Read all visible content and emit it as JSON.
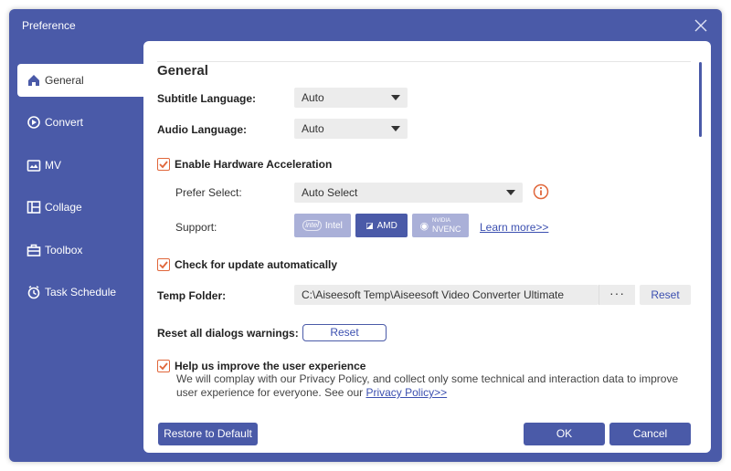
{
  "window": {
    "title": "Preference"
  },
  "sidebar": {
    "items": [
      {
        "label": "General",
        "icon": "home-icon",
        "active": true
      },
      {
        "label": "Convert",
        "icon": "convert-icon",
        "active": false
      },
      {
        "label": "MV",
        "icon": "mv-icon",
        "active": false
      },
      {
        "label": "Collage",
        "icon": "collage-icon",
        "active": false
      },
      {
        "label": "Toolbox",
        "icon": "toolbox-icon",
        "active": false
      },
      {
        "label": "Task Schedule",
        "icon": "clock-icon",
        "active": false
      }
    ]
  },
  "general": {
    "heading": "General",
    "subtitle_language": {
      "label": "Subtitle Language:",
      "value": "Auto"
    },
    "audio_language": {
      "label": "Audio Language:",
      "value": "Auto"
    },
    "hardware_acceleration": {
      "label": "Enable Hardware Acceleration",
      "checked": true,
      "prefer_label": "Prefer Select:",
      "prefer_value": "Auto Select",
      "support_label": "Support:",
      "intel": "Intel",
      "amd": "AMD",
      "nvidia_top": "NVIDIA",
      "nvidia_bottom": "NVENC",
      "learn_more": "Learn more>>"
    },
    "check_update": {
      "label": "Check for update automatically",
      "checked": true
    },
    "temp_folder": {
      "label": "Temp Folder:",
      "path": "C:\\Aiseesoft Temp\\Aiseesoft Video Converter Ultimate",
      "dots": "···",
      "reset": "Reset"
    },
    "reset_dialogs": {
      "label": "Reset all dialogs warnings:",
      "button": "Reset"
    },
    "improve": {
      "label": "Help us improve the user experience",
      "checked": true,
      "text": "We will complay with our Privacy Policy, and collect only some technical and interaction data to improve user experience for everyone. See our ",
      "link": "Privacy Policy>>"
    }
  },
  "footer": {
    "restore": "Restore to Default",
    "ok": "OK",
    "cancel": "Cancel"
  },
  "colors": {
    "accent": "#4a5aa8",
    "check": "#e0663a",
    "gpu_inactive": "#aab0d8",
    "gpu_active": "#4a5aa8"
  }
}
